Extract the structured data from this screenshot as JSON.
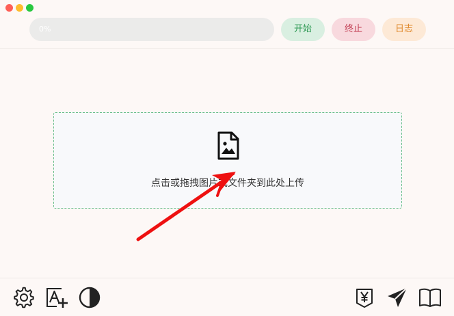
{
  "toolbar": {
    "progress": {
      "text": "0%",
      "value": 0
    },
    "start_label": "开始",
    "stop_label": "终止",
    "log_label": "日志"
  },
  "dropzone": {
    "hint": "点击或拖拽图片或文件夹到此处上传",
    "icon": "image-file-icon"
  },
  "footer": {
    "left_icons": [
      "settings-icon",
      "font-add-icon",
      "contrast-icon"
    ],
    "right_icons": [
      "donate-yen-icon",
      "send-icon",
      "book-icon"
    ]
  },
  "colors": {
    "background": "#fdf8f6",
    "start": "#2f9a55",
    "stop": "#c0394f",
    "log": "#e0892c",
    "dropzone_border": "#6cbf8c",
    "annotation_arrow": "#ee1111"
  }
}
